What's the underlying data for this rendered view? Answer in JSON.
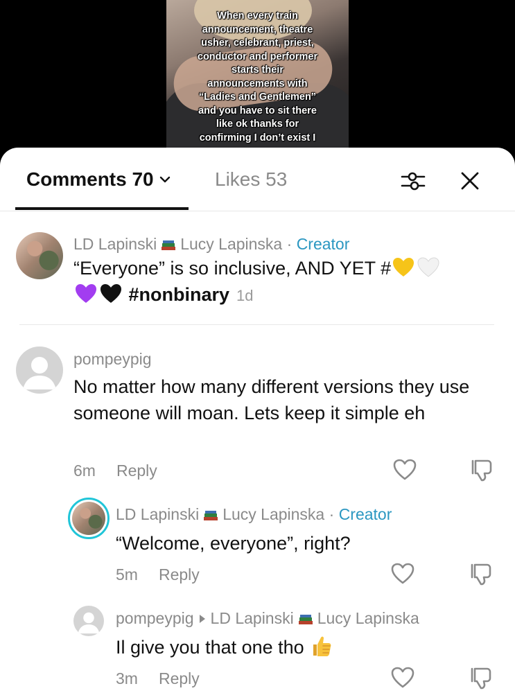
{
  "video": {
    "caption": "When every train\nannouncement, theatre\nusher, celebrant, priest,\nconductor and performer\nstarts their\nannouncements with\n“Ladies and Gentlemen”\nand you have to sit there\nlike ok thanks for\nconfirming I don’t exist I"
  },
  "tabs": {
    "comments_label": "Comments 70",
    "likes_label": "Likes 53"
  },
  "comments": [
    {
      "name": "LD Lapinski",
      "name2": "Lucy Lapinska",
      "badge": "Creator",
      "text_a": "“Everyone” is so inclusive, AND YET #",
      "text_b": "#nonbinary",
      "time": "1d"
    },
    {
      "name": "pompeypig",
      "text": "No matter how many different versions they use someone will moan. Lets keep it simple eh",
      "time": "6m",
      "reply": "Reply"
    },
    {
      "name": "LD Lapinski",
      "name2": "Lucy Lapinska",
      "badge": "Creator",
      "text": "“Welcome, everyone”, right?",
      "time": "5m",
      "reply": "Reply"
    },
    {
      "name": "pompeypig",
      "reply_to": "LD Lapinski",
      "name2": "Lucy Lapinska",
      "text": "Il give you that one tho",
      "time": "3m",
      "reply": "Reply"
    }
  ],
  "colors": {
    "creator": "#2b97c1",
    "muted": "#8a8a8a",
    "story_ring": "#20c5d8"
  },
  "icons": [
    "filter-icon",
    "close-icon",
    "chevron-down-icon",
    "heart-icon",
    "dislike-icon",
    "books-emoji",
    "thumbs-up-emoji"
  ]
}
